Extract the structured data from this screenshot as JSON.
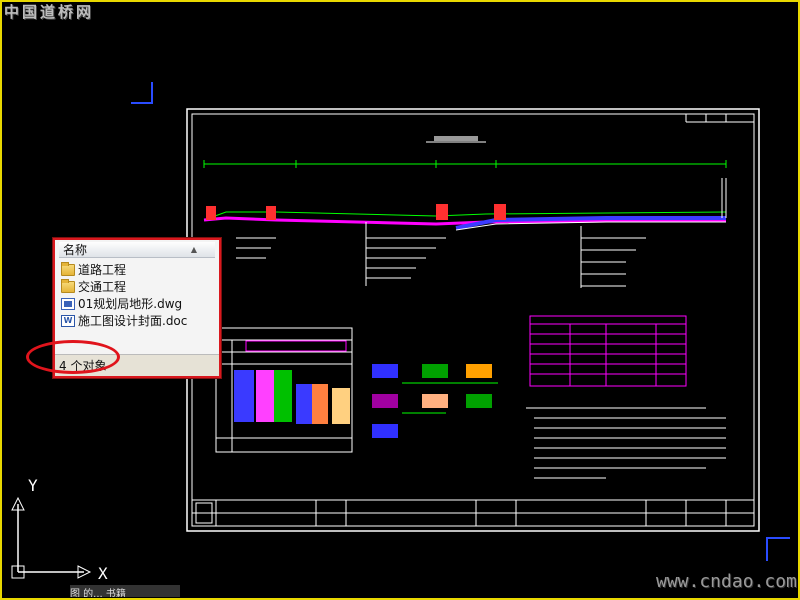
{
  "watermark": {
    "top": "中国道桥网",
    "bottom": "www.cndao.com"
  },
  "explorer": {
    "column_header": "名称",
    "items": [
      {
        "name": "道路工程",
        "type": "folder"
      },
      {
        "name": "交通工程",
        "type": "folder"
      },
      {
        "name": "01规划局地形.dwg",
        "type": "dwg-file"
      },
      {
        "name": "施工图设计封面.doc",
        "type": "doc-file"
      }
    ],
    "status": "4 个对象"
  },
  "ucs": {
    "x_label": "X",
    "y_label": "Y"
  },
  "bottom_strip_text": "图 的... 书籍",
  "colors": {
    "frame": "#e8d800",
    "callout": "#d9181e",
    "corner_marks": "#2a4cff",
    "drawing_lines": "#ffffff",
    "accent_magenta": "#ff00ff",
    "accent_green": "#00ff00"
  }
}
